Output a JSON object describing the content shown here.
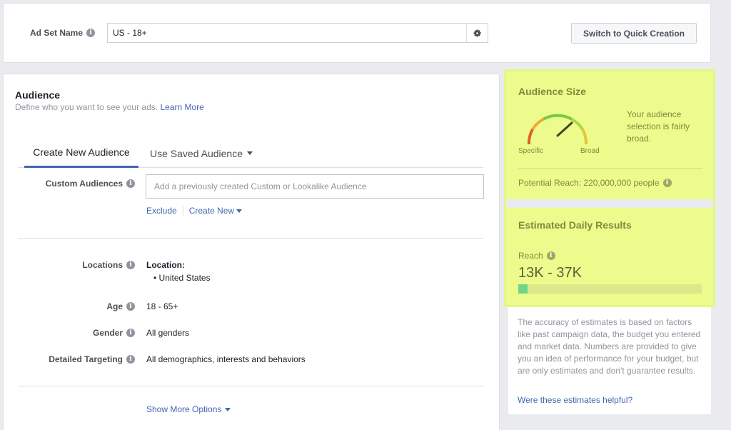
{
  "top": {
    "ad_set_label": "Ad Set Name",
    "ad_set_value": "US - 18+",
    "switch_button": "Switch to Quick Creation"
  },
  "audience": {
    "title": "Audience",
    "subtitle": "Define who you want to see your ads.",
    "learn_more": "Learn More",
    "tabs": [
      {
        "label": "Create New Audience",
        "active": true
      },
      {
        "label": "Use Saved Audience",
        "active": false
      }
    ],
    "custom_audiences": {
      "label": "Custom Audiences",
      "placeholder": "Add a previously created Custom or Lookalike Audience",
      "exclude": "Exclude",
      "create_new": "Create New"
    },
    "locations": {
      "label": "Locations",
      "title": "Location:",
      "items": [
        "United States"
      ]
    },
    "age": {
      "label": "Age",
      "value": "18 - 65+"
    },
    "gender": {
      "label": "Gender",
      "value": "All genders"
    },
    "detailed_targeting": {
      "label": "Detailed Targeting",
      "value": "All demographics, interests and behaviors"
    },
    "show_more": "Show More Options"
  },
  "audience_size": {
    "title": "Audience Size",
    "description": "Your audience selection is fairly broad.",
    "gauge_left": "Specific",
    "gauge_right": "Broad",
    "potential_reach": "Potential Reach: 220,000,000 people"
  },
  "estimated_daily": {
    "title": "Estimated Daily Results",
    "reach_label": "Reach",
    "reach_value": "13K - 37K",
    "reach_fill_fraction": 0.05,
    "note": "The accuracy of estimates is based on factors like past campaign data, the budget you entered and market data. Numbers are provided to give you an idea of performance for your budget, but are only estimates and don't guarantee results.",
    "helpful_link": "Were these estimates helpful?"
  },
  "colors": {
    "link": "#4267b2",
    "highlight": "#ecfb8b",
    "reach_fill": "#6fd686"
  }
}
